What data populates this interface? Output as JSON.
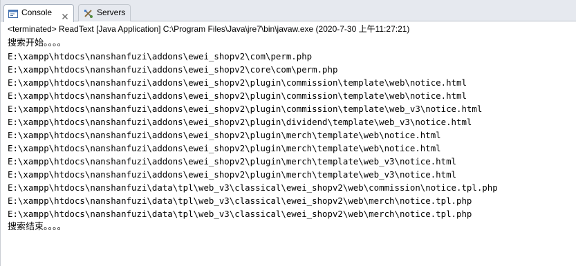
{
  "tabs": {
    "console": {
      "label": "Console",
      "icon": "console-icon",
      "close_icon": "close-icon"
    },
    "servers": {
      "label": "Servers",
      "icon": "servers-icon"
    }
  },
  "status_line": "<terminated> ReadText [Java Application] C:\\Program Files\\Java\\jre7\\bin\\javaw.exe (2020-7-30 上午11:27:21)",
  "output": {
    "lines": [
      "搜索开始。。。。",
      "E:\\xampp\\htdocs\\nanshanfuzi\\addons\\ewei_shopv2\\com\\perm.php",
      "E:\\xampp\\htdocs\\nanshanfuzi\\addons\\ewei_shopv2\\core\\com\\perm.php",
      "E:\\xampp\\htdocs\\nanshanfuzi\\addons\\ewei_shopv2\\plugin\\commission\\template\\web\\notice.html",
      "E:\\xampp\\htdocs\\nanshanfuzi\\addons\\ewei_shopv2\\plugin\\commission\\template\\web\\notice.html",
      "E:\\xampp\\htdocs\\nanshanfuzi\\addons\\ewei_shopv2\\plugin\\commission\\template\\web_v3\\notice.html",
      "E:\\xampp\\htdocs\\nanshanfuzi\\addons\\ewei_shopv2\\plugin\\dividend\\template\\web_v3\\notice.html",
      "E:\\xampp\\htdocs\\nanshanfuzi\\addons\\ewei_shopv2\\plugin\\merch\\template\\web\\notice.html",
      "E:\\xampp\\htdocs\\nanshanfuzi\\addons\\ewei_shopv2\\plugin\\merch\\template\\web\\notice.html",
      "E:\\xampp\\htdocs\\nanshanfuzi\\addons\\ewei_shopv2\\plugin\\merch\\template\\web_v3\\notice.html",
      "E:\\xampp\\htdocs\\nanshanfuzi\\addons\\ewei_shopv2\\plugin\\merch\\template\\web_v3\\notice.html",
      "E:\\xampp\\htdocs\\nanshanfuzi\\data\\tpl\\web_v3\\classical\\ewei_shopv2\\web\\commission\\notice.tpl.php",
      "E:\\xampp\\htdocs\\nanshanfuzi\\data\\tpl\\web_v3\\classical\\ewei_shopv2\\web\\merch\\notice.tpl.php",
      "E:\\xampp\\htdocs\\nanshanfuzi\\data\\tpl\\web_v3\\classical\\ewei_shopv2\\web\\merch\\notice.tpl.php",
      "搜索结束。。。。"
    ]
  }
}
